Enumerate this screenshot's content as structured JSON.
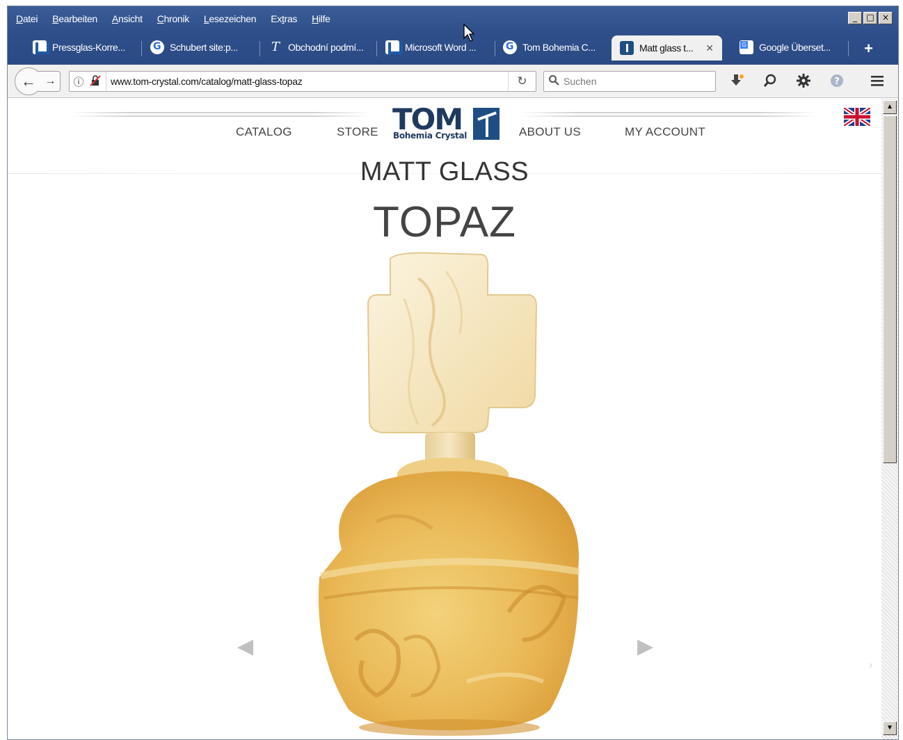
{
  "menu": [
    "Datei",
    "Bearbeiten",
    "Ansicht",
    "Chronik",
    "Lesezeichen",
    "Extras",
    "Hilfe"
  ],
  "menu_accel": [
    "D",
    "B",
    "A",
    "C",
    "L",
    "t",
    "H"
  ],
  "window_controls": [
    "_",
    "□",
    "×"
  ],
  "tabs": [
    {
      "label": "Pressglas-Korre...",
      "icon": "u-icon"
    },
    {
      "label": "Schubert site:p...",
      "icon": "google-icon"
    },
    {
      "label": "Obchodní podmí...",
      "icon": "t-icon"
    },
    {
      "label": "Microsoft Word ...",
      "icon": "u-icon"
    },
    {
      "label": "Tom Bohemia C...",
      "icon": "google-icon"
    },
    {
      "label": "Matt glass t...",
      "icon": "tom-icon",
      "active": true
    },
    {
      "label": "Google Überset...",
      "icon": "google-translate-icon"
    }
  ],
  "new_tab": "+",
  "nav": {
    "url": "www.tom-crystal.com/catalog/matt-glass-topaz",
    "search_placeholder": "Suchen",
    "back": "←",
    "forward": "→",
    "info": "ⓘ",
    "reload": "↻"
  },
  "site": {
    "nav_left": [
      "CATALOG",
      "STORE"
    ],
    "nav_right": [
      "ABOUT US",
      "MY ACCOUNT"
    ],
    "logo_word": "TOM",
    "logo_sub": "Bohemia Crystal",
    "category": "MATT GLASS",
    "product": "TOPAZ",
    "prev_arrow": "◀",
    "next_arrow": "▶"
  },
  "colors": {
    "titlebar": "#2e4f8a",
    "logo_blue": "#1e3a5f",
    "topaz_glass": "#e8b660"
  }
}
